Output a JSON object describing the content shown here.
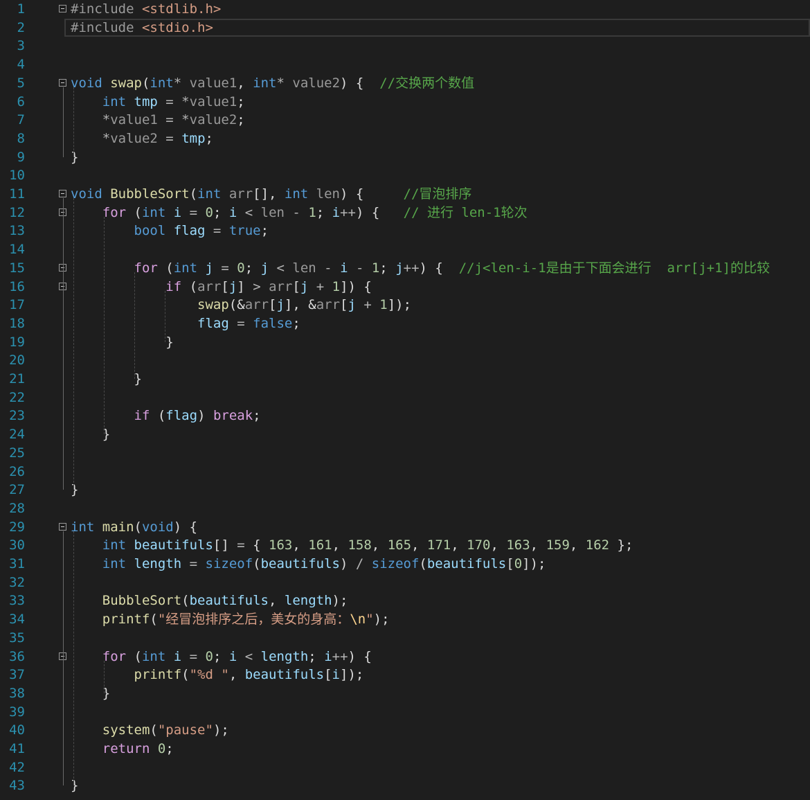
{
  "editor": {
    "lines": [
      {
        "n": "1",
        "fold": true,
        "tokens": [
          [
            "pp",
            "#include "
          ],
          [
            "inc",
            "<stdlib.h>"
          ]
        ]
      },
      {
        "n": "2",
        "current": true,
        "tokens": [
          [
            "pp",
            "#include "
          ],
          [
            "inc",
            "<stdio.h>"
          ]
        ]
      },
      {
        "n": "3",
        "tokens": []
      },
      {
        "n": "4",
        "tokens": []
      },
      {
        "n": "5",
        "fold": true,
        "tokens": [
          [
            "kw",
            "void "
          ],
          [
            "fn",
            "swap"
          ],
          [
            "plain",
            "("
          ],
          [
            "kw",
            "int"
          ],
          [
            "op",
            "* "
          ],
          [
            "param",
            "value1"
          ],
          [
            "plain",
            ", "
          ],
          [
            "kw",
            "int"
          ],
          [
            "op",
            "* "
          ],
          [
            "param",
            "value2"
          ],
          [
            "plain",
            ") {  "
          ],
          [
            "cmt",
            "//交换两个数值"
          ]
        ]
      },
      {
        "n": "6",
        "tokens": [
          [
            "plain",
            "    "
          ],
          [
            "kw",
            "int "
          ],
          [
            "var",
            "tmp"
          ],
          [
            "op",
            " = *"
          ],
          [
            "param",
            "value1"
          ],
          [
            "plain",
            ";"
          ]
        ]
      },
      {
        "n": "7",
        "tokens": [
          [
            "plain",
            "    "
          ],
          [
            "op",
            "*"
          ],
          [
            "param",
            "value1"
          ],
          [
            "op",
            " = *"
          ],
          [
            "param",
            "value2"
          ],
          [
            "plain",
            ";"
          ]
        ]
      },
      {
        "n": "8",
        "tokens": [
          [
            "plain",
            "    "
          ],
          [
            "op",
            "*"
          ],
          [
            "param",
            "value2"
          ],
          [
            "op",
            " = "
          ],
          [
            "var",
            "tmp"
          ],
          [
            "plain",
            ";"
          ]
        ]
      },
      {
        "n": "9",
        "tokens": [
          [
            "plain",
            "}"
          ]
        ]
      },
      {
        "n": "10",
        "tokens": []
      },
      {
        "n": "11",
        "fold": true,
        "tokens": [
          [
            "kw",
            "void "
          ],
          [
            "fn",
            "BubbleSort"
          ],
          [
            "plain",
            "("
          ],
          [
            "kw",
            "int "
          ],
          [
            "param",
            "arr"
          ],
          [
            "plain",
            "[], "
          ],
          [
            "kw",
            "int "
          ],
          [
            "param",
            "len"
          ],
          [
            "plain",
            ") {     "
          ],
          [
            "cmt",
            "//冒泡排序"
          ]
        ]
      },
      {
        "n": "12",
        "fold": true,
        "tokens": [
          [
            "plain",
            "    "
          ],
          [
            "ctrl",
            "for "
          ],
          [
            "plain",
            "("
          ],
          [
            "kw",
            "int "
          ],
          [
            "var",
            "i"
          ],
          [
            "op",
            " = "
          ],
          [
            "num",
            "0"
          ],
          [
            "plain",
            "; "
          ],
          [
            "var",
            "i"
          ],
          [
            "op",
            " < "
          ],
          [
            "param",
            "len"
          ],
          [
            "op",
            " - "
          ],
          [
            "num",
            "1"
          ],
          [
            "plain",
            "; "
          ],
          [
            "var",
            "i"
          ],
          [
            "op",
            "++"
          ],
          [
            "plain",
            ") {   "
          ],
          [
            "cmt",
            "// 进行 len-1轮次"
          ]
        ]
      },
      {
        "n": "13",
        "tokens": [
          [
            "plain",
            "        "
          ],
          [
            "kw",
            "bool "
          ],
          [
            "var",
            "flag"
          ],
          [
            "op",
            " = "
          ],
          [
            "kw",
            "true"
          ],
          [
            "plain",
            ";"
          ]
        ]
      },
      {
        "n": "14",
        "tokens": []
      },
      {
        "n": "15",
        "fold": true,
        "tokens": [
          [
            "plain",
            "        "
          ],
          [
            "ctrl",
            "for "
          ],
          [
            "plain",
            "("
          ],
          [
            "kw",
            "int "
          ],
          [
            "var",
            "j"
          ],
          [
            "op",
            " = "
          ],
          [
            "num",
            "0"
          ],
          [
            "plain",
            "; "
          ],
          [
            "var",
            "j"
          ],
          [
            "op",
            " < "
          ],
          [
            "param",
            "len"
          ],
          [
            "op",
            " - "
          ],
          [
            "var",
            "i"
          ],
          [
            "op",
            " - "
          ],
          [
            "num",
            "1"
          ],
          [
            "plain",
            "; "
          ],
          [
            "var",
            "j"
          ],
          [
            "op",
            "++"
          ],
          [
            "plain",
            ") {  "
          ],
          [
            "cmt",
            "//j<len-i-1是由于下面会进行  arr[j+1]的比较"
          ]
        ]
      },
      {
        "n": "16",
        "fold": true,
        "tokens": [
          [
            "plain",
            "            "
          ],
          [
            "ctrl",
            "if "
          ],
          [
            "plain",
            "("
          ],
          [
            "param",
            "arr"
          ],
          [
            "plain",
            "["
          ],
          [
            "var",
            "j"
          ],
          [
            "plain",
            "] "
          ],
          [
            "op",
            "> "
          ],
          [
            "param",
            "arr"
          ],
          [
            "plain",
            "["
          ],
          [
            "var",
            "j"
          ],
          [
            "op",
            " + "
          ],
          [
            "num",
            "1"
          ],
          [
            "plain",
            "]) {"
          ]
        ]
      },
      {
        "n": "17",
        "tokens": [
          [
            "plain",
            "                "
          ],
          [
            "fn",
            "swap"
          ],
          [
            "plain",
            "(&"
          ],
          [
            "param",
            "arr"
          ],
          [
            "plain",
            "["
          ],
          [
            "var",
            "j"
          ],
          [
            "plain",
            "], &"
          ],
          [
            "param",
            "arr"
          ],
          [
            "plain",
            "["
          ],
          [
            "var",
            "j"
          ],
          [
            "op",
            " + "
          ],
          [
            "num",
            "1"
          ],
          [
            "plain",
            "]);"
          ]
        ]
      },
      {
        "n": "18",
        "tokens": [
          [
            "plain",
            "                "
          ],
          [
            "var",
            "flag"
          ],
          [
            "op",
            " = "
          ],
          [
            "kw",
            "false"
          ],
          [
            "plain",
            ";"
          ]
        ]
      },
      {
        "n": "19",
        "tokens": [
          [
            "plain",
            "            }"
          ]
        ]
      },
      {
        "n": "20",
        "tokens": []
      },
      {
        "n": "21",
        "tokens": [
          [
            "plain",
            "        }"
          ]
        ]
      },
      {
        "n": "22",
        "tokens": []
      },
      {
        "n": "23",
        "tokens": [
          [
            "plain",
            "        "
          ],
          [
            "ctrl",
            "if "
          ],
          [
            "plain",
            "("
          ],
          [
            "var",
            "flag"
          ],
          [
            "plain",
            ") "
          ],
          [
            "ctrl",
            "break"
          ],
          [
            "plain",
            ";"
          ]
        ]
      },
      {
        "n": "24",
        "tokens": [
          [
            "plain",
            "    }"
          ]
        ]
      },
      {
        "n": "25",
        "tokens": []
      },
      {
        "n": "26",
        "tokens": []
      },
      {
        "n": "27",
        "tokens": [
          [
            "plain",
            "}"
          ]
        ]
      },
      {
        "n": "28",
        "tokens": []
      },
      {
        "n": "29",
        "fold": true,
        "tokens": [
          [
            "kw",
            "int "
          ],
          [
            "fn",
            "main"
          ],
          [
            "plain",
            "("
          ],
          [
            "kw",
            "void"
          ],
          [
            "plain",
            ") {"
          ]
        ]
      },
      {
        "n": "30",
        "tokens": [
          [
            "plain",
            "    "
          ],
          [
            "kw",
            "int "
          ],
          [
            "var",
            "beautifuls"
          ],
          [
            "plain",
            "[] "
          ],
          [
            "op",
            "= "
          ],
          [
            "plain",
            "{ "
          ],
          [
            "num",
            "163"
          ],
          [
            "plain",
            ", "
          ],
          [
            "num",
            "161"
          ],
          [
            "plain",
            ", "
          ],
          [
            "num",
            "158"
          ],
          [
            "plain",
            ", "
          ],
          [
            "num",
            "165"
          ],
          [
            "plain",
            ", "
          ],
          [
            "num",
            "171"
          ],
          [
            "plain",
            ", "
          ],
          [
            "num",
            "170"
          ],
          [
            "plain",
            ", "
          ],
          [
            "num",
            "163"
          ],
          [
            "plain",
            ", "
          ],
          [
            "num",
            "159"
          ],
          [
            "plain",
            ", "
          ],
          [
            "num",
            "162"
          ],
          [
            "plain",
            " };"
          ]
        ]
      },
      {
        "n": "31",
        "tokens": [
          [
            "plain",
            "    "
          ],
          [
            "kw",
            "int "
          ],
          [
            "var",
            "length"
          ],
          [
            "op",
            " = "
          ],
          [
            "kw",
            "sizeof"
          ],
          [
            "plain",
            "("
          ],
          [
            "var",
            "beautifuls"
          ],
          [
            "plain",
            ") "
          ],
          [
            "op",
            "/ "
          ],
          [
            "kw",
            "sizeof"
          ],
          [
            "plain",
            "("
          ],
          [
            "var",
            "beautifuls"
          ],
          [
            "plain",
            "["
          ],
          [
            "num",
            "0"
          ],
          [
            "plain",
            "]);"
          ]
        ]
      },
      {
        "n": "32",
        "tokens": []
      },
      {
        "n": "33",
        "tokens": [
          [
            "plain",
            "    "
          ],
          [
            "fn",
            "BubbleSort"
          ],
          [
            "plain",
            "("
          ],
          [
            "var",
            "beautifuls"
          ],
          [
            "plain",
            ", "
          ],
          [
            "var",
            "length"
          ],
          [
            "plain",
            ");"
          ]
        ]
      },
      {
        "n": "34",
        "tokens": [
          [
            "plain",
            "    "
          ],
          [
            "fn",
            "printf"
          ],
          [
            "plain",
            "("
          ],
          [
            "str",
            "\"经冒泡排序之后，美女的身高："
          ],
          [
            "esc",
            "\\n"
          ],
          [
            "str",
            "\""
          ],
          [
            "plain",
            ");"
          ]
        ]
      },
      {
        "n": "35",
        "tokens": []
      },
      {
        "n": "36",
        "fold": true,
        "tokens": [
          [
            "plain",
            "    "
          ],
          [
            "ctrl",
            "for "
          ],
          [
            "plain",
            "("
          ],
          [
            "kw",
            "int "
          ],
          [
            "var",
            "i"
          ],
          [
            "op",
            " = "
          ],
          [
            "num",
            "0"
          ],
          [
            "plain",
            "; "
          ],
          [
            "var",
            "i"
          ],
          [
            "op",
            " < "
          ],
          [
            "var",
            "length"
          ],
          [
            "plain",
            "; "
          ],
          [
            "var",
            "i"
          ],
          [
            "op",
            "++"
          ],
          [
            "plain",
            ") {"
          ]
        ]
      },
      {
        "n": "37",
        "tokens": [
          [
            "plain",
            "        "
          ],
          [
            "fn",
            "printf"
          ],
          [
            "plain",
            "("
          ],
          [
            "str",
            "\"%d \""
          ],
          [
            "plain",
            ", "
          ],
          [
            "var",
            "beautifuls"
          ],
          [
            "plain",
            "["
          ],
          [
            "var",
            "i"
          ],
          [
            "plain",
            "]);"
          ]
        ]
      },
      {
        "n": "38",
        "tokens": [
          [
            "plain",
            "    }"
          ]
        ]
      },
      {
        "n": "39",
        "tokens": []
      },
      {
        "n": "40",
        "tokens": [
          [
            "plain",
            "    "
          ],
          [
            "fn",
            "system"
          ],
          [
            "plain",
            "("
          ],
          [
            "str",
            "\"pause\""
          ],
          [
            "plain",
            ");"
          ]
        ]
      },
      {
        "n": "41",
        "tokens": [
          [
            "plain",
            "    "
          ],
          [
            "ctrl",
            "return "
          ],
          [
            "num",
            "0"
          ],
          [
            "plain",
            ";"
          ]
        ]
      },
      {
        "n": "42",
        "tokens": []
      },
      {
        "n": "43",
        "tokens": [
          [
            "plain",
            "}"
          ]
        ]
      }
    ]
  },
  "colors": {
    "background": "#1e1e1e",
    "line_number": "#2b91af",
    "keyword": "#569cd6",
    "control": "#d8a0df",
    "function": "#dcdcaa",
    "variable": "#9cdcfe",
    "number": "#b5cea8",
    "string": "#d69d85",
    "comment": "#57a64a"
  }
}
